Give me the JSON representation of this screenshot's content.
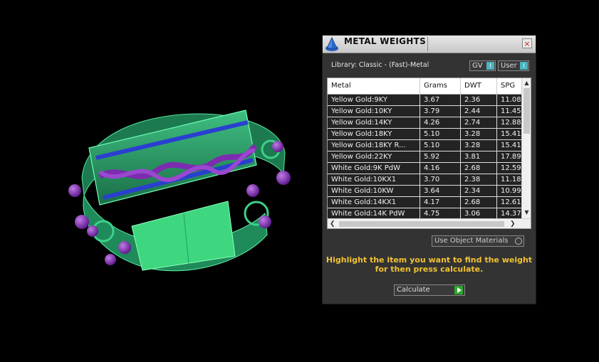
{
  "panel": {
    "title": "METAL WEIGHTS",
    "close_label": "×",
    "library_label": "Library: Classic - (Fast)-Metal",
    "toggles": {
      "gv_label": "GV",
      "user_label": "User",
      "gv_mark": "I",
      "user_mark": "I"
    },
    "table": {
      "columns": [
        "Metal",
        "Grams",
        "DWT",
        "SPG"
      ],
      "rows": [
        [
          "Yellow Gold:9KY",
          "3.67",
          "2.36",
          "11.08"
        ],
        [
          "Yellow Gold:10KY",
          "3.79",
          "2.44",
          "11.45"
        ],
        [
          "Yellow Gold:14KY",
          "4.26",
          "2.74",
          "12.88"
        ],
        [
          "Yellow Gold:18KY",
          "5.10",
          "3.28",
          "15.41"
        ],
        [
          "Yellow Gold:18KY R...",
          "5.10",
          "3.28",
          "15.41"
        ],
        [
          "Yellow Gold:22KY",
          "5.92",
          "3.81",
          "17.89"
        ],
        [
          "White Gold:9K PdW",
          "4.16",
          "2.68",
          "12.59"
        ],
        [
          "White Gold:10KX1",
          "3.70",
          "2.38",
          "11.18"
        ],
        [
          "White Gold:10KW",
          "3.64",
          "2.34",
          "10.99"
        ],
        [
          "White Gold:14KX1",
          "4.17",
          "2.68",
          "12.61"
        ],
        [
          "White Gold:14K PdW",
          "4.75",
          "3.06",
          "14.37"
        ]
      ]
    },
    "use_object_materials_label": "Use Object Materials",
    "instructions": "Highlight the item you want to find the weight for then press calculate.",
    "calculate_label": "Calculate"
  },
  "colors": {
    "ring_green": "#2e9e6a",
    "ring_purple": "#7d2bb0",
    "gem_blue": "#2a3fd0",
    "accent_yellow": "#f2c233"
  }
}
